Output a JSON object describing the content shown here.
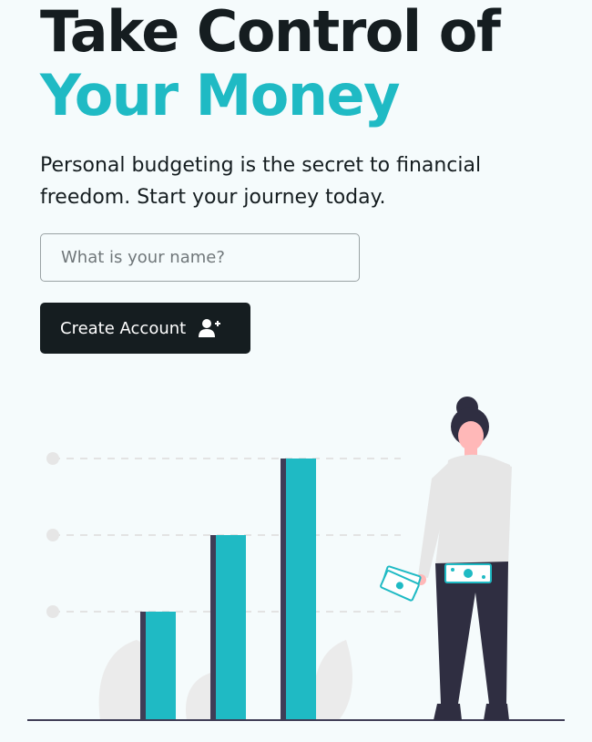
{
  "hero": {
    "title_line1": "Take Control of",
    "title_line2": "Your Money",
    "subtitle": "Personal budgeting is the secret to financial freedom. Start your journey today."
  },
  "form": {
    "name_placeholder": "What is your name?",
    "name_value": "",
    "submit_label": "Create Account",
    "submit_icon": "user-plus-icon"
  },
  "colors": {
    "accent": "#1fbac4",
    "dark": "#151d20",
    "background": "#f5fbfc"
  },
  "illustration": {
    "bar_levels": [
      1,
      2,
      3
    ],
    "icon": "woman-holding-money-illustration"
  }
}
